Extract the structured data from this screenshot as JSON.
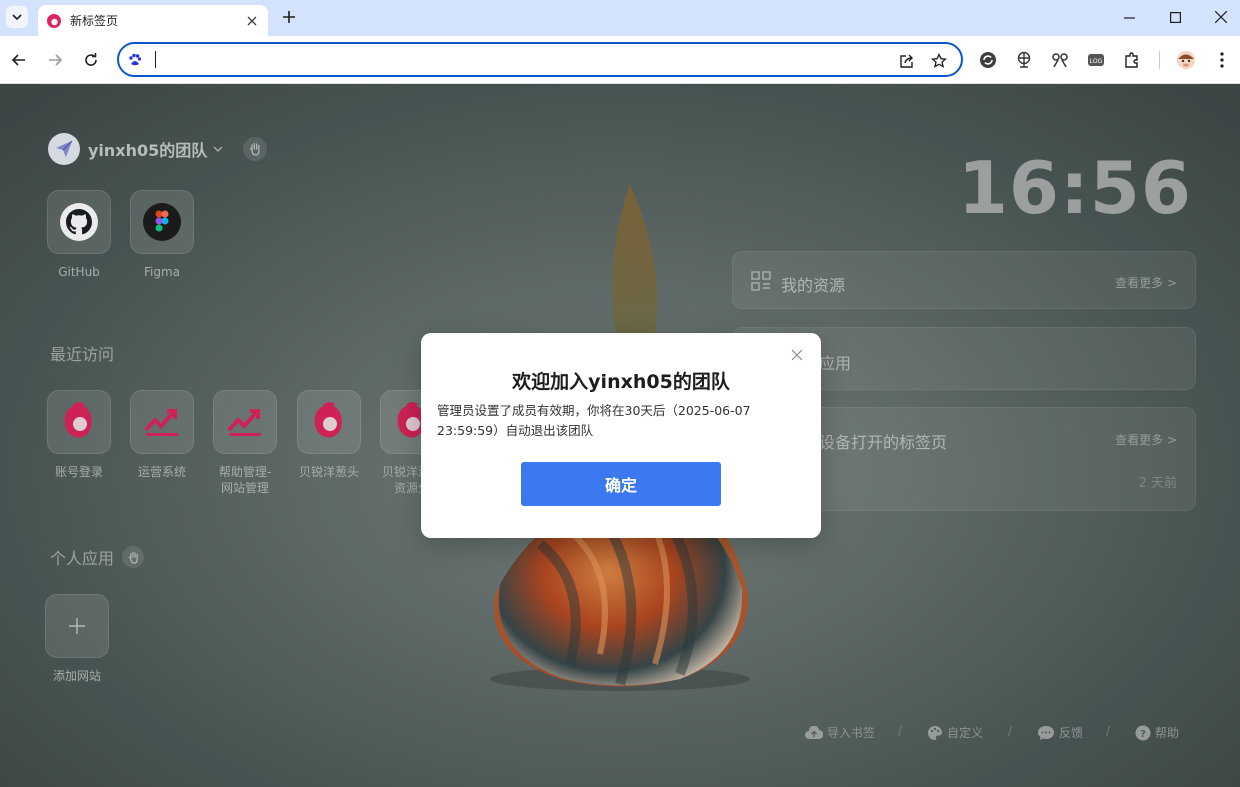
{
  "browser": {
    "tab": {
      "title": "新标签页"
    },
    "omnibox": {
      "value": "",
      "placeholder": ""
    }
  },
  "page": {
    "team": {
      "name": "yinxh05的团队"
    },
    "pinned_sites": [
      {
        "label": "GitHub"
      },
      {
        "label": "Figma"
      }
    ],
    "recent": {
      "title": "最近访问",
      "items": [
        {
          "label": "账号登录"
        },
        {
          "label": "运营系统"
        },
        {
          "label": "帮助管理-网站管理"
        },
        {
          "label": "贝锐洋葱头"
        },
        {
          "label": "贝锐洋葱头资源分"
        }
      ]
    },
    "personal": {
      "title": "个人应用",
      "add_label": "添加网站"
    },
    "clock": "16:56",
    "panels": {
      "resources": {
        "title": "我的资源",
        "more": "查看更多 >"
      },
      "apps": {
        "title": "应用"
      },
      "devices": {
        "title": "设备打开的标签页",
        "more": "查看更多 >",
        "time": "2 天前"
      }
    },
    "footer": {
      "import": "导入书签",
      "customize": "自定义",
      "feedback": "反馈",
      "help": "帮助"
    }
  },
  "modal": {
    "title": "欢迎加入yinxh05的团队",
    "body": "管理员设置了成员有效期，你将在30天后（2025-06-07 23:59:59）自动退出该团队",
    "confirm": "确定"
  },
  "colors": {
    "accent": "#0b57d0",
    "confirm_button": "#3c78f0",
    "brand_red": "#e0245e"
  }
}
